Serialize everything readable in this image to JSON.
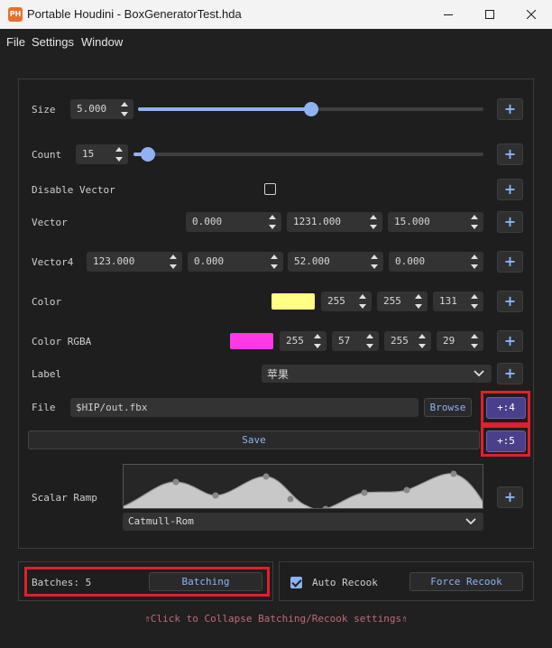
{
  "window": {
    "icon_text": "PH",
    "title": "Portable Houdini - BoxGeneratorTest.hda"
  },
  "menu": [
    "File",
    "Settings",
    "Window"
  ],
  "params": {
    "size": {
      "label": "Size",
      "value": "5.000",
      "fraction": 0.5
    },
    "count": {
      "label": "Count",
      "value": "15",
      "fraction": 0.04
    },
    "disable_vector": {
      "label": "Disable Vector",
      "checked": false
    },
    "vector": {
      "label": "Vector",
      "values": [
        "0.000",
        "1231.000",
        "15.000"
      ]
    },
    "vector4": {
      "label": "Vector4",
      "values": [
        "123.000",
        "0.000",
        "52.000",
        "0.000"
      ]
    },
    "color": {
      "label": "Color",
      "swatch": "#ffff83",
      "values": [
        "255",
        "255",
        "131"
      ]
    },
    "color_rgba": {
      "label": "Color RGBA",
      "swatch": "#ff39e5",
      "values": [
        "255",
        "57",
        "255",
        "29"
      ]
    },
    "label": {
      "label": "Label",
      "value": "苹果"
    },
    "file": {
      "label": "File",
      "value": "$HIP/out.fbx",
      "browse": "Browse"
    },
    "save": {
      "label": "Save"
    },
    "scalar_ramp": {
      "label": "Scalar Ramp",
      "interpolation": "Catmull-Rom"
    }
  },
  "plus_buttons": {
    "plus": "+",
    "file_plus": "+:4",
    "save_plus": "+:5"
  },
  "batching": {
    "label": "Batches: 5",
    "button": "Batching"
  },
  "recook": {
    "auto_label": "Auto Recook",
    "auto_checked": true,
    "force_button": "Force Recook"
  },
  "footer": "⇑Click to Collapse Batching/Recook settings⇑",
  "colors": {
    "accent": "#8ab4f8",
    "highlight": "#e0202a",
    "plus_active": "#4a3f8a",
    "footer_text": "#c06a78"
  }
}
